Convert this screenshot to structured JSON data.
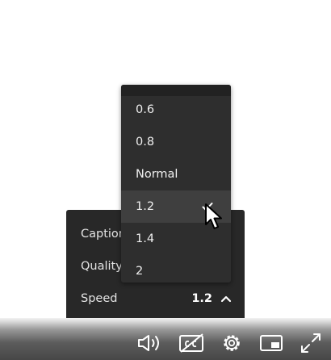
{
  "settings_menu": {
    "rows": [
      {
        "label": "Captions"
      },
      {
        "label": "Quality"
      },
      {
        "label": "Speed",
        "value": "1.2"
      }
    ]
  },
  "speed_menu": {
    "options": [
      {
        "label": "0.6"
      },
      {
        "label": "0.8"
      },
      {
        "label": "Normal"
      },
      {
        "label": "1.2",
        "selected": true
      },
      {
        "label": "1.4"
      },
      {
        "label": "2"
      }
    ]
  },
  "controls": {
    "icons": [
      "volume-icon",
      "captions-off-icon",
      "settings-icon",
      "picture-in-picture-icon",
      "fullscreen-icon"
    ]
  },
  "colors": {
    "menu_bg": "#282828",
    "dropdown_bg": "#2e2e2e",
    "selected_bg": "#3f3f3f",
    "text": "#f0f0f0"
  }
}
